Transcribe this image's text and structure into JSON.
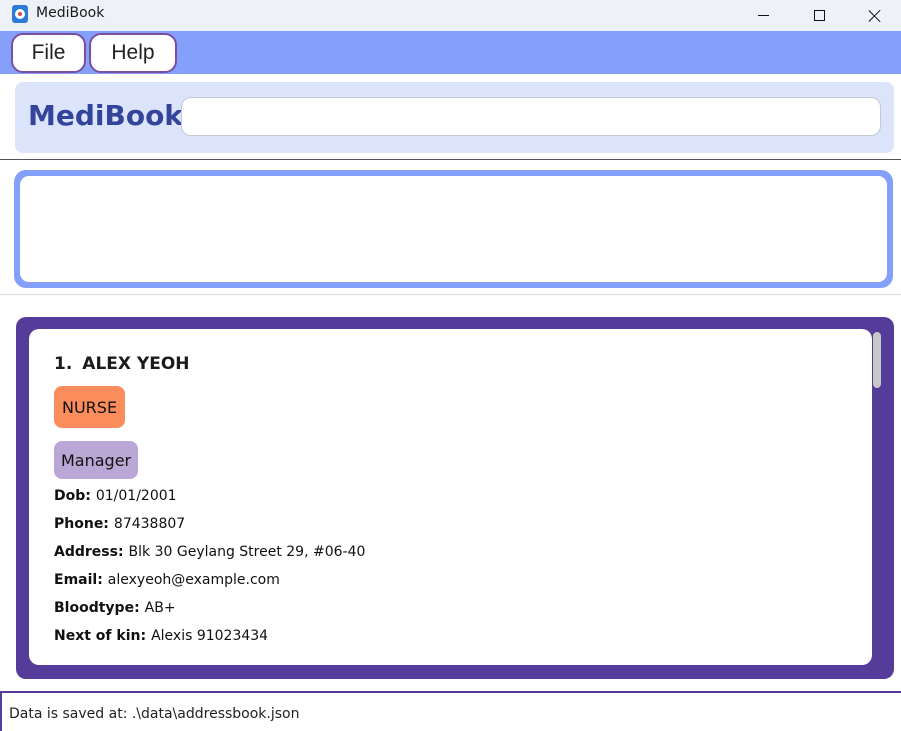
{
  "window": {
    "title": "MediBook",
    "icon": "medibook-app-icon"
  },
  "menu": {
    "file_label": "File",
    "help_label": "Help"
  },
  "header": {
    "logo": "MediBook",
    "command_input": {
      "value": "",
      "placeholder": ""
    }
  },
  "result_display": {
    "text": ""
  },
  "person_list": {
    "items": [
      {
        "index": "1.",
        "name": "ALEX YEOH",
        "role": "NURSE",
        "tags": [
          "Manager"
        ],
        "fields": {
          "dob": {
            "label": "Dob:",
            "value": "01/01/2001"
          },
          "phone": {
            "label": "Phone:",
            "value": "87438807"
          },
          "address": {
            "label": "Address:",
            "value": "Blk 30 Geylang Street 29, #06-40"
          },
          "email": {
            "label": "Email:",
            "value": "alexyeoh@example.com"
          },
          "bloodtype": {
            "label": "Bloodtype:",
            "value": "AB+"
          },
          "next_of_kin": {
            "label": "Next of kin:",
            "value": "Alexis 91023434"
          }
        }
      }
    ]
  },
  "status_bar": {
    "text": "Data is saved at: .\\data\\addressbook.json"
  },
  "colors": {
    "menubar": "#85a0fb",
    "menu_border": "#7b4fa0",
    "header_panel": "#dce4fb",
    "logo": "#33459a",
    "result_border": "#85a0fb",
    "list_background": "#553c9a",
    "role_tag": "#fb8c5c",
    "tag_chip": "#bba7d6"
  }
}
